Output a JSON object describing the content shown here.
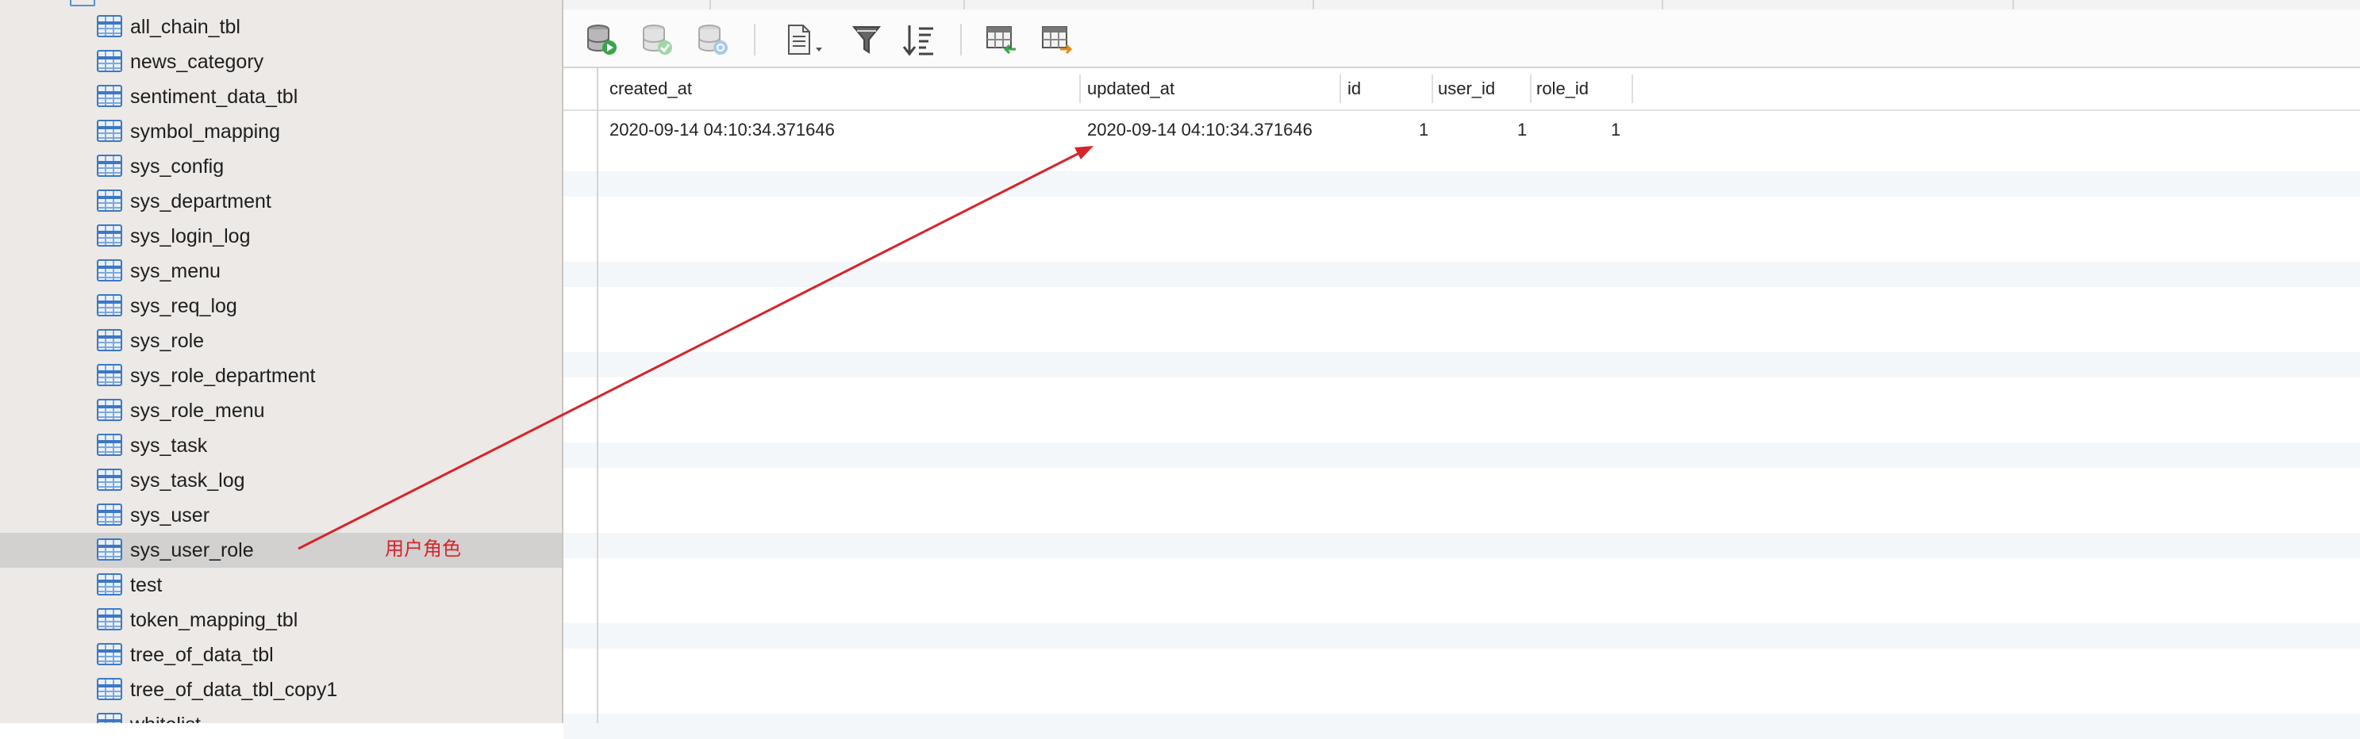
{
  "sidebar": {
    "tables": [
      {
        "name": "all_chain_tbl"
      },
      {
        "name": "news_category"
      },
      {
        "name": "sentiment_data_tbl"
      },
      {
        "name": "symbol_mapping"
      },
      {
        "name": "sys_config"
      },
      {
        "name": "sys_department"
      },
      {
        "name": "sys_login_log"
      },
      {
        "name": "sys_menu"
      },
      {
        "name": "sys_req_log"
      },
      {
        "name": "sys_role"
      },
      {
        "name": "sys_role_department"
      },
      {
        "name": "sys_role_menu"
      },
      {
        "name": "sys_task"
      },
      {
        "name": "sys_task_log"
      },
      {
        "name": "sys_user"
      },
      {
        "name": "sys_user_role",
        "selected": true
      },
      {
        "name": "test"
      },
      {
        "name": "token_mapping_tbl"
      },
      {
        "name": "tree_of_data_tbl"
      },
      {
        "name": "tree_of_data_tbl_copy1"
      },
      {
        "name": "whitelist"
      }
    ],
    "annotation": "用户角色"
  },
  "toolbar": {
    "icons": [
      "db-run-icon",
      "db-apply-icon",
      "db-info-icon",
      "document-menu-icon",
      "filter-icon",
      "sort-icon",
      "import-table-icon",
      "export-table-icon"
    ]
  },
  "grid": {
    "columns": [
      "created_at",
      "updated_at",
      "id",
      "user_id",
      "role_id"
    ],
    "rows": [
      {
        "created_at": "2020-09-14 04:10:34.371646",
        "updated_at": "2020-09-14 04:10:34.371646",
        "id": "1",
        "user_id": "1",
        "role_id": "1"
      }
    ]
  },
  "colors": {
    "accent": "#d8232a",
    "sidebar_bg": "#ece9e6",
    "selected_row": "#d2d1d0",
    "table_icon": "#3d78c3"
  }
}
